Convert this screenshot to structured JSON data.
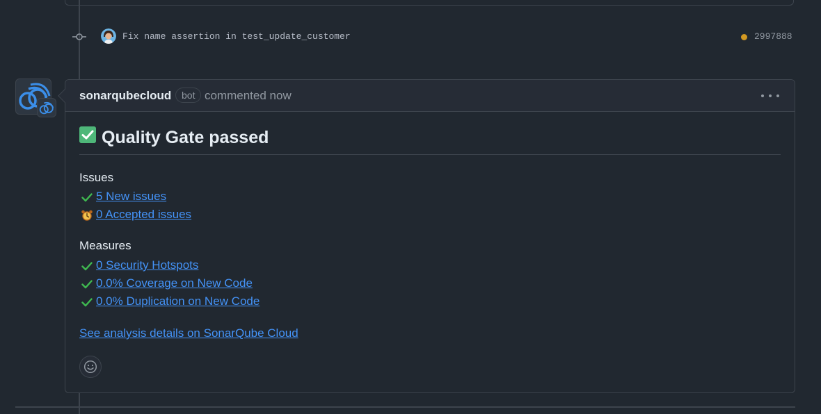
{
  "commit": {
    "message": "Fix name assertion in test_update_customer",
    "sha": "2997888",
    "status_color": "#d29922"
  },
  "comment": {
    "author": "sonarqubecloud",
    "bot_label": "bot",
    "timestamp": "commented now",
    "heading": "Quality Gate passed",
    "issues_title": "Issues",
    "issues": [
      {
        "icon": "check-icon",
        "label": "5 New issues"
      },
      {
        "icon": "alarm-clock-icon",
        "label": "0 Accepted issues"
      }
    ],
    "measures_title": "Measures",
    "measures": [
      {
        "icon": "check-icon",
        "label": "0 Security Hotspots"
      },
      {
        "icon": "check-icon",
        "label": "0.0% Coverage on New Code"
      },
      {
        "icon": "check-icon",
        "label": "0.0% Duplication on New Code"
      }
    ],
    "details_link": "See analysis details on SonarQube Cloud"
  },
  "colors": {
    "background": "#212830",
    "link": "#4493f8",
    "success": "#3fb950",
    "pending": "#d29922"
  }
}
